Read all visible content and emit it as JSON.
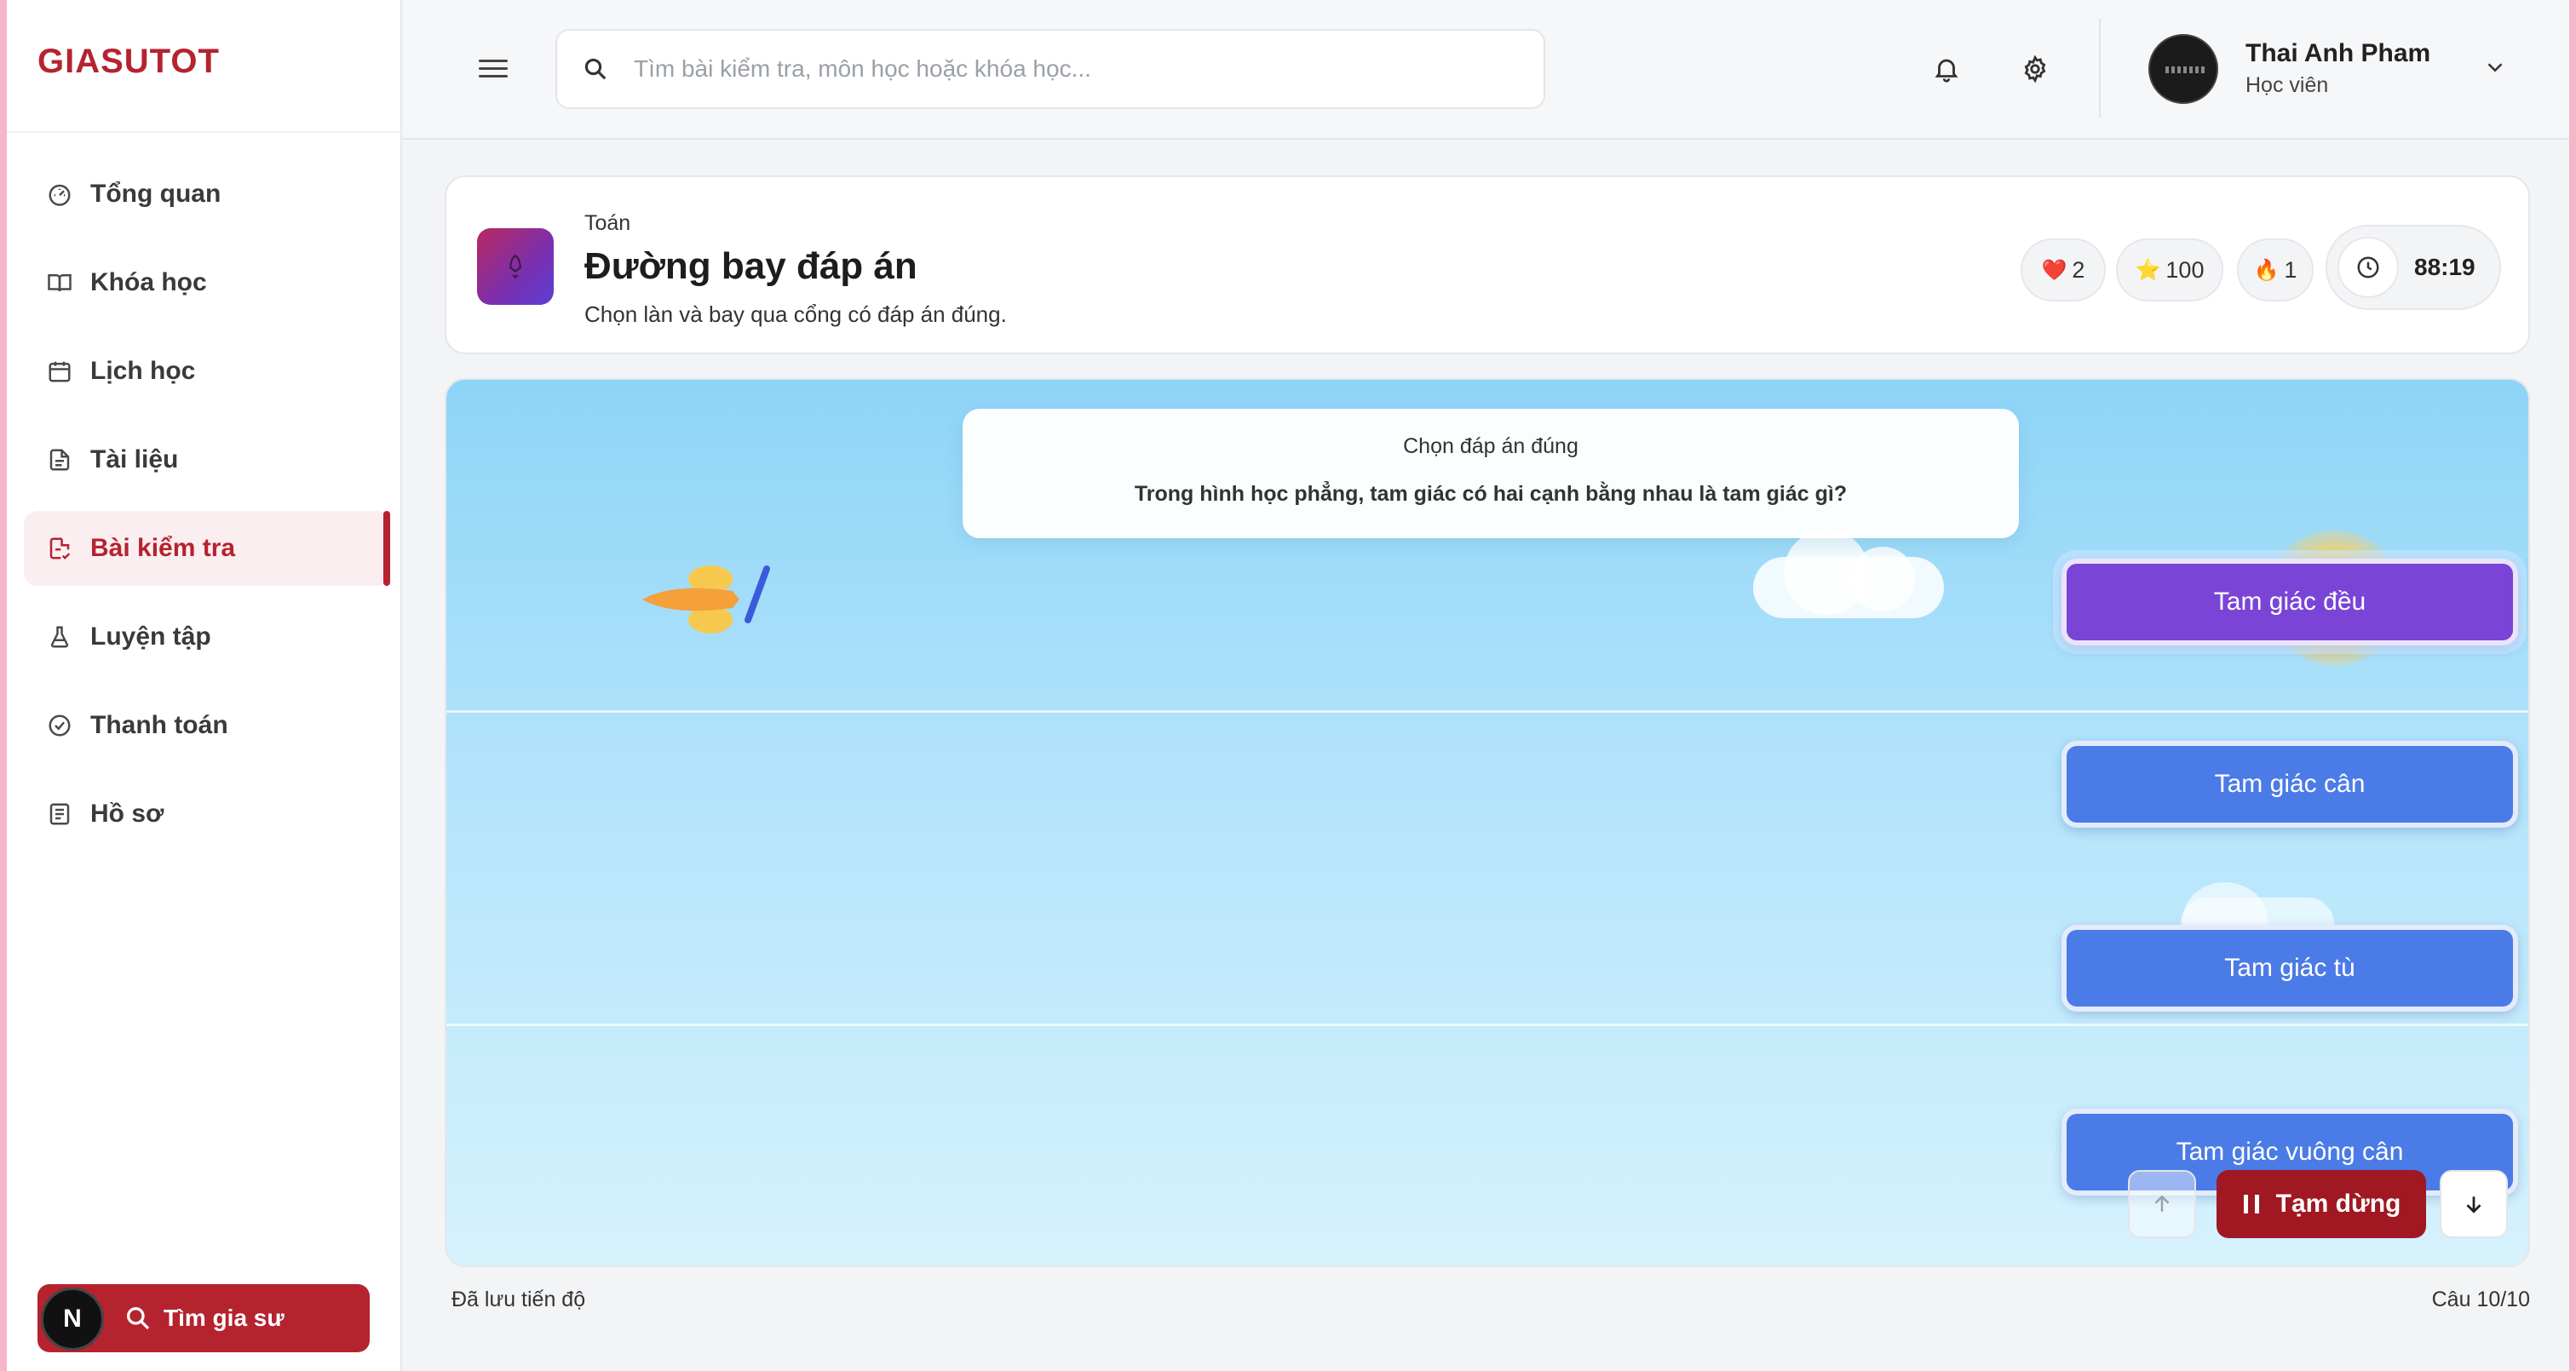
{
  "brand": "GIASUTOT",
  "sidebar": {
    "items": [
      {
        "label": "Tổng quan",
        "icon": "gauge-icon"
      },
      {
        "label": "Khóa học",
        "icon": "book-open-icon"
      },
      {
        "label": "Lịch học",
        "icon": "calendar-icon"
      },
      {
        "label": "Tài liệu",
        "icon": "file-text-icon"
      },
      {
        "label": "Bài kiểm tra",
        "icon": "clipboard-check-icon",
        "active": true
      },
      {
        "label": "Luyện tập",
        "icon": "flask-icon"
      },
      {
        "label": "Thanh toán",
        "icon": "payment-icon"
      },
      {
        "label": "Hồ sơ",
        "icon": "profile-icon"
      }
    ],
    "find_tutor_label": "Tìm gia sư",
    "next_badge": "N"
  },
  "topbar": {
    "search_placeholder": "Tìm bài kiểm tra, môn học hoặc khóa học...",
    "user_name": "Thai Anh Pham",
    "user_role": "Học viên"
  },
  "game": {
    "subject": "Toán",
    "title": "Đường bay đáp án",
    "description": "Chọn làn và bay qua cổng có đáp án đúng.",
    "hearts": "2",
    "stars": "100",
    "streak": "1",
    "timer": "88:19",
    "question_hint": "Chọn đáp án đúng",
    "question_text": "Trong hình học phẳng, tam giác có hai cạnh bằng nhau là tam giác gì?",
    "answers": [
      "Tam giác đều",
      "Tam giác cân",
      "Tam giác tù",
      "Tam giác vuông cân"
    ],
    "selected_answer_index": 0,
    "pause_label": "Tạm dừng",
    "saved_status": "Đã lưu tiến độ",
    "question_counter": "Câu 10/10"
  },
  "colors": {
    "brand": "#b5232f",
    "answer": "#4b7be7",
    "answer_selected": "#7a45d6",
    "pause": "#a01822"
  }
}
